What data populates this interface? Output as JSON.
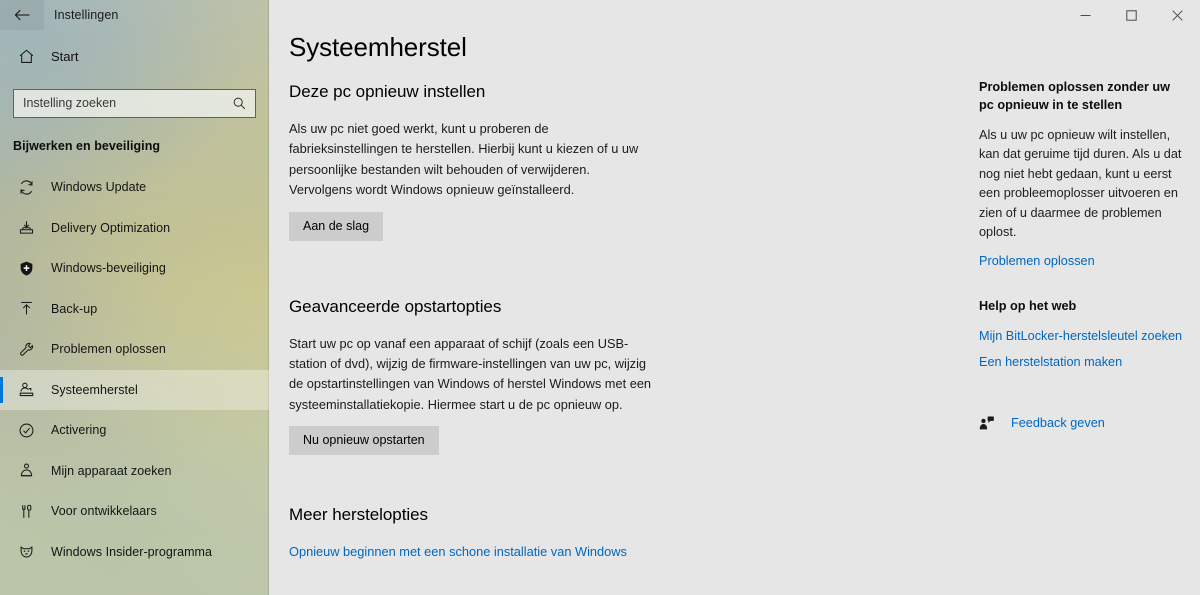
{
  "window": {
    "title": "Instellingen",
    "back_icon": "back-arrow-icon",
    "minimize_label": "Minimaliseren",
    "maximize_label": "Maximaliseren",
    "close_label": "Sluiten",
    "accent_color": "#0078d7",
    "background_color": "#e6e6e6",
    "link_color": "#0067c0"
  },
  "sidebar": {
    "home": {
      "label": "Start",
      "icon": "home-icon"
    },
    "search": {
      "placeholder": "Instelling zoeken",
      "value": "",
      "icon": "search-icon"
    },
    "category": "Bijwerken en beveiliging",
    "items": [
      {
        "label": "Windows Update",
        "icon": "refresh-icon",
        "selected": false
      },
      {
        "label": "Delivery Optimization",
        "icon": "download-box-icon",
        "selected": false
      },
      {
        "label": "Windows-beveiliging",
        "icon": "shield-icon",
        "selected": false
      },
      {
        "label": "Back-up",
        "icon": "upload-arrow-icon",
        "selected": false
      },
      {
        "label": "Problemen oplossen",
        "icon": "wrench-icon",
        "selected": false
      },
      {
        "label": "Systeemherstel",
        "icon": "recovery-icon",
        "selected": true
      },
      {
        "label": "Activering",
        "icon": "check-circle-icon",
        "selected": false
      },
      {
        "label": "Mijn apparaat zoeken",
        "icon": "find-device-icon",
        "selected": false
      },
      {
        "label": "Voor ontwikkelaars",
        "icon": "developer-tools-icon",
        "selected": false
      },
      {
        "label": "Windows Insider-programma",
        "icon": "insider-cat-icon",
        "selected": false
      }
    ]
  },
  "main": {
    "page_title": "Systeemherstel",
    "sections": [
      {
        "title": "Deze pc opnieuw instellen",
        "body": "Als uw pc niet goed werkt, kunt u proberen de fabrieksinstellingen te herstellen. Hierbij kunt u kiezen of u uw persoonlijke bestanden wilt behouden of verwijderen. Vervolgens wordt Windows opnieuw geïnstalleerd.",
        "button": "Aan de slag"
      },
      {
        "title": "Geavanceerde opstartopties",
        "body": "Start uw pc op vanaf een apparaat of schijf (zoals een USB-station of dvd), wijzig de firmware-instellingen van uw pc, wijzig de opstartinstellingen van Windows of herstel Windows met een systeeminstallatiekopie. Hiermee start u de pc opnieuw op.",
        "button": "Nu opnieuw opstarten"
      }
    ],
    "more_options": {
      "title": "Meer herstelopties",
      "link": "Opnieuw beginnen met een schone installatie van Windows"
    }
  },
  "rail": {
    "troubleshoot": {
      "title": "Problemen oplossen zonder uw pc opnieuw in te stellen",
      "body": "Als u uw pc opnieuw wilt instellen, kan dat geruime tijd duren. Als u dat nog niet hebt gedaan, kunt u eerst een probleemoplosser uitvoeren en zien of u daarmee de problemen oplost.",
      "link": "Problemen oplossen"
    },
    "help": {
      "title": "Help op het web",
      "links": [
        "Mijn BitLocker-herstelsleutel zoeken",
        "Een herstelstation maken"
      ]
    },
    "feedback": {
      "label": "Feedback geven",
      "icon": "feedback-person-icon"
    }
  }
}
